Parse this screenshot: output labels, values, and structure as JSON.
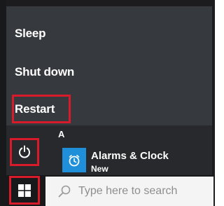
{
  "power_menu": {
    "items": [
      {
        "label": "Sleep"
      },
      {
        "label": "Shut down"
      },
      {
        "label": "Restart"
      }
    ]
  },
  "start_menu": {
    "letter_header": "A",
    "apps": [
      {
        "name": "Alarms & Clock",
        "badge": "New",
        "icon": "alarm-clock-icon"
      }
    ],
    "power_icon": "power-icon"
  },
  "taskbar": {
    "start_icon": "windows-logo-icon",
    "search": {
      "placeholder": "Type here to search",
      "icon": "search-icon"
    }
  },
  "colors": {
    "highlight": "#d81b2a",
    "app_tile": "#1e8fd8",
    "menu_bg": "#36393d"
  }
}
